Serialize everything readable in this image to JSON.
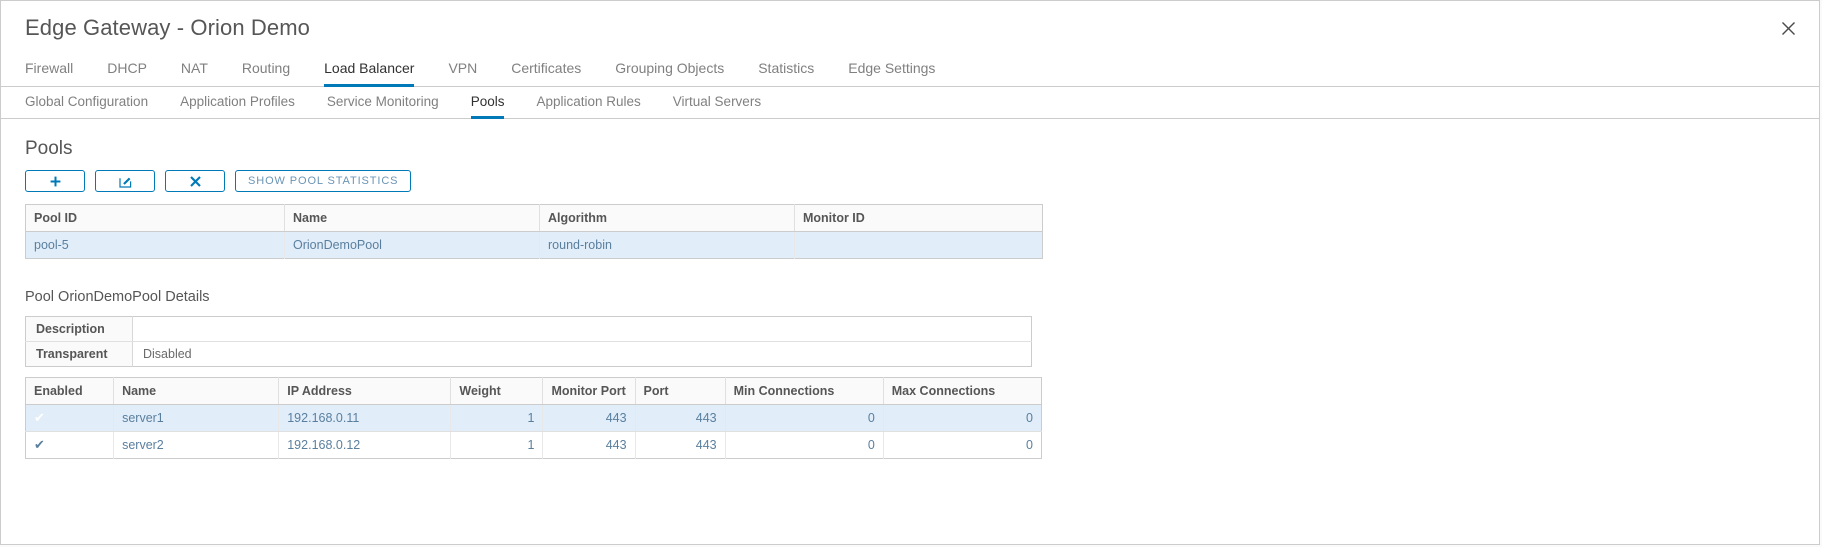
{
  "window": {
    "title": "Edge Gateway - Orion Demo",
    "close_icon": "close-icon"
  },
  "tabs": [
    {
      "label": "Firewall",
      "active": false
    },
    {
      "label": "DHCP",
      "active": false
    },
    {
      "label": "NAT",
      "active": false
    },
    {
      "label": "Routing",
      "active": false
    },
    {
      "label": "Load Balancer",
      "active": true
    },
    {
      "label": "VPN",
      "active": false
    },
    {
      "label": "Certificates",
      "active": false
    },
    {
      "label": "Grouping Objects",
      "active": false
    },
    {
      "label": "Statistics",
      "active": false
    },
    {
      "label": "Edge Settings",
      "active": false
    }
  ],
  "subtabs": [
    {
      "label": "Global Configuration",
      "active": false
    },
    {
      "label": "Application Profiles",
      "active": false
    },
    {
      "label": "Service Monitoring",
      "active": false
    },
    {
      "label": "Pools",
      "active": true
    },
    {
      "label": "Application Rules",
      "active": false
    },
    {
      "label": "Virtual Servers",
      "active": false
    }
  ],
  "pools_section": {
    "heading": "Pools",
    "toolbar": {
      "add_icon": "plus-icon",
      "edit_icon": "edit-pencil-icon",
      "delete_icon": "close-x-icon",
      "statistics_label": "SHOW POOL STATISTICS"
    },
    "table": {
      "columns": [
        "Pool ID",
        "Name",
        "Algorithm",
        "Monitor ID"
      ],
      "rows": [
        {
          "pool_id": "pool-5",
          "name": "OrionDemoPool",
          "algorithm": "round-robin",
          "monitor_id": "",
          "selected": true
        }
      ]
    }
  },
  "details_section": {
    "heading": "Pool OrionDemoPool Details",
    "properties": [
      {
        "label": "Description",
        "value": ""
      },
      {
        "label": "Transparent",
        "value": "Disabled"
      }
    ],
    "members_table": {
      "columns": [
        "Enabled",
        "Name",
        "IP Address",
        "Weight",
        "Monitor Port",
        "Port",
        "Min Connections",
        "Max Connections"
      ],
      "rows": [
        {
          "enabled": "✔",
          "name": "server1",
          "ip_address": "192.168.0.11",
          "weight": "1",
          "monitor_port": "443",
          "port": "443",
          "min_connections": "0",
          "max_connections": "0",
          "selected": true
        },
        {
          "enabled": "✔",
          "name": "server2",
          "ip_address": "192.168.0.12",
          "weight": "1",
          "monitor_port": "443",
          "port": "443",
          "min_connections": "0",
          "max_connections": "0",
          "selected": false
        }
      ]
    }
  },
  "colors": {
    "accent": "#0079b8",
    "selection": "#1f9bdf",
    "row_selected": "#e1eefa",
    "text": "#565656",
    "link_text": "#5a7f9e"
  }
}
